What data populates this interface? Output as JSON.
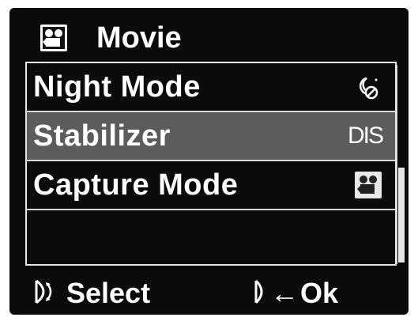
{
  "header": {
    "title": "Movie",
    "icon": "movie-camera-icon"
  },
  "menu": {
    "items": [
      {
        "label": "Night Mode",
        "icon": "night-mode-off-icon",
        "selected": false
      },
      {
        "label": "Stabilizer",
        "value": "DIS",
        "selected": true
      },
      {
        "label": "Capture Mode",
        "icon": "movie-camera-icon",
        "selected": false
      }
    ]
  },
  "footer": {
    "select_label": "Select",
    "select_icon": "rotate-dial-icon",
    "ok_label": "Ok",
    "ok_prefix": "←",
    "ok_icon": "press-button-icon"
  },
  "colors": {
    "background": "#0b0b0b",
    "selected_row": "#5c5c5c",
    "text": "#ffffff"
  }
}
